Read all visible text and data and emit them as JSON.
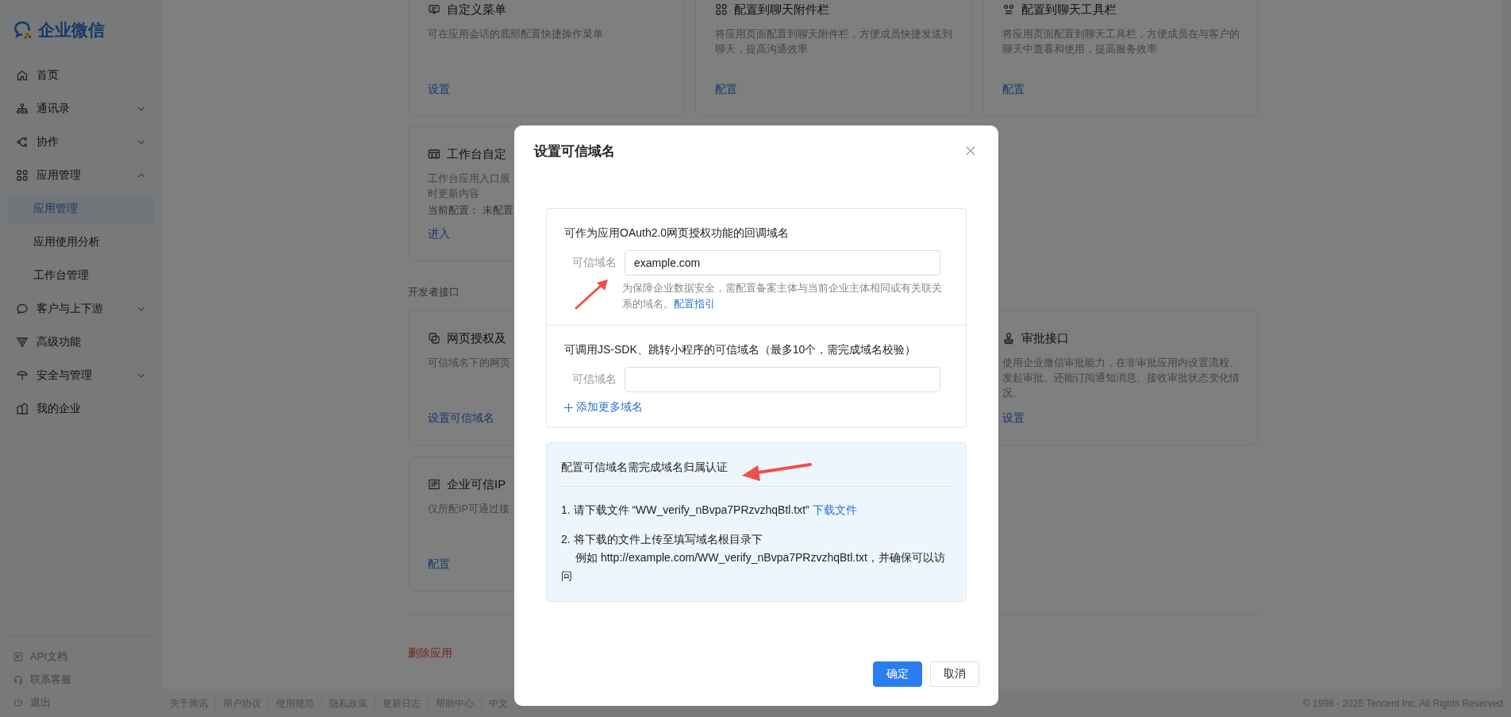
{
  "sidebar": {
    "logo": "企业微信",
    "items": [
      {
        "label": "首页",
        "selected": false
      },
      {
        "label": "通讯录",
        "selected": false,
        "expanded": false
      },
      {
        "label": "协作",
        "selected": false,
        "expanded": false
      },
      {
        "label": "应用管理",
        "selected": false,
        "expanded": true,
        "children": [
          {
            "label": "应用管理",
            "selected": true
          },
          {
            "label": "应用使用分析",
            "selected": false
          },
          {
            "label": "工作台管理",
            "selected": false
          }
        ]
      },
      {
        "label": "客户与上下游",
        "selected": false,
        "expanded": false
      },
      {
        "label": "高级功能",
        "selected": false
      },
      {
        "label": "安全与管理",
        "selected": false,
        "expanded": false
      },
      {
        "label": "我的企业",
        "selected": false
      }
    ],
    "bottom_links": [
      "API文档",
      "联系客服",
      "退出"
    ]
  },
  "feature_cards": [
    {
      "title": "自定义菜单",
      "description_lines": [
        "可在应用会话的底部配置快捷操作菜单"
      ],
      "action": "设置"
    },
    {
      "title": "配置到聊天附件栏",
      "description_lines": [
        "将应用页面配置到聊天附件栏，方便成员快捷发送到",
        "聊天，提高沟通效率"
      ],
      "action": "配置"
    },
    {
      "title": "配置到聊天工具栏",
      "description_lines": [
        "将应用页面配置到聊天工具栏，方便成员在与客户的",
        "聊天中查看和使用，提高服务效率"
      ],
      "action": "配置"
    },
    {
      "title": "工作台自定",
      "description_lines": [
        "工作台应用入口展",
        "时更新内容"
      ],
      "meta": "当前配置： 未配置",
      "action": "进入"
    }
  ],
  "developer_section": {
    "title": "开发者接口",
    "cards": [
      {
        "title": "网页授权及",
        "description_lines": [
          "可信域名下的网页"
        ],
        "action": "设置可信域名"
      },
      {
        "title": "审批接口",
        "description_lines": [
          "使用企业微信审批能力，在非审批应用内设置流程、",
          "发起审批。还能订阅通知消息、接收审批状态变化情",
          "况。"
        ],
        "action": "设置"
      },
      {
        "title": "企业可信IP",
        "description_lines": [
          "仅所配IP可通过接"
        ],
        "action": "配置"
      }
    ]
  },
  "delete_button": "删除应用",
  "footer": {
    "links": [
      "关于腾讯",
      "用户协议",
      "使用规范",
      "隐私政策",
      "更新日志",
      "帮助中心",
      "中文"
    ],
    "copyright": "© 1998 - 2025 Tencent Inc. All Rights Reserved"
  },
  "dialog": {
    "title": "设置可信域名",
    "oauth_section": {
      "heading": "可作为应用OAuth2.0网页授权功能的回调域名",
      "field_label": "可信域名",
      "value": "example.com",
      "hint": "为保障企业数据安全，需配置备案主体与当前企业主体相同或有关联关系的域名。",
      "hint_link": "配置指引"
    },
    "jssdk_section": {
      "heading": "可调用JS-SDK、跳转小程序的可信域名（最多10个，需完成域名校验）",
      "field_label": "可信域名",
      "add_link": "添加更多域名"
    },
    "verify_notice": {
      "title": "配置可信域名需完成域名归属认证",
      "steps": [
        {
          "text": "1. 请下载文件 “WW_verify_nBvpa7PRzvzhqBtl.txt”",
          "link": "下载文件"
        },
        {
          "text": "2. 将下载的文件上传至填写域名根目录下",
          "example": "例如 http://example.com/WW_verify_nBvpa7PRzvzhqBtl.txt，并确保可以访问"
        }
      ]
    },
    "buttons": [
      {
        "label": "确定",
        "kind": "primary"
      },
      {
        "label": "取消",
        "kind": "default"
      }
    ]
  }
}
